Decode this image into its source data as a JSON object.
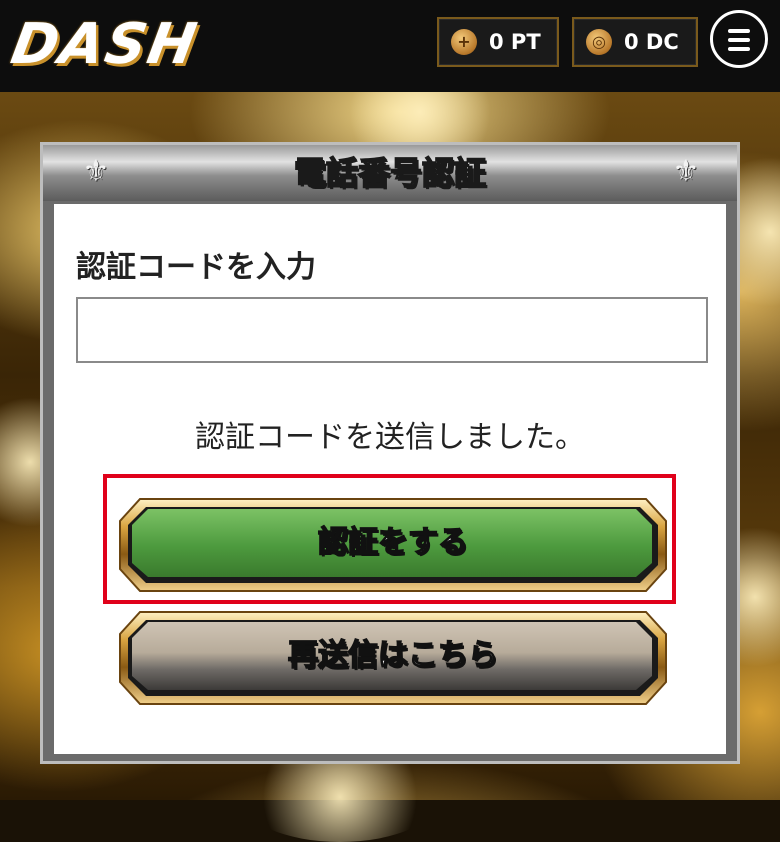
{
  "header": {
    "logo_text": "DASH",
    "points": {
      "icon": "pt-coin-icon",
      "value": "0 PT"
    },
    "coins": {
      "icon": "dc-coin-icon",
      "value": "0 DC"
    },
    "menu_icon": "hamburger-menu-icon"
  },
  "dialog": {
    "title": "電話番号認証",
    "code_label": "認証コードを入力",
    "code_input": {
      "value": "",
      "placeholder": ""
    },
    "sent_message": "認証コードを送信しました。",
    "verify_button": "認証をする",
    "resend_button": "再送信はこちら"
  },
  "colors": {
    "verify_button": "#4d9a3e",
    "resend_button": "#b7ab9a",
    "highlight_border": "#e0001a",
    "gold_frame": "#c9912b"
  }
}
